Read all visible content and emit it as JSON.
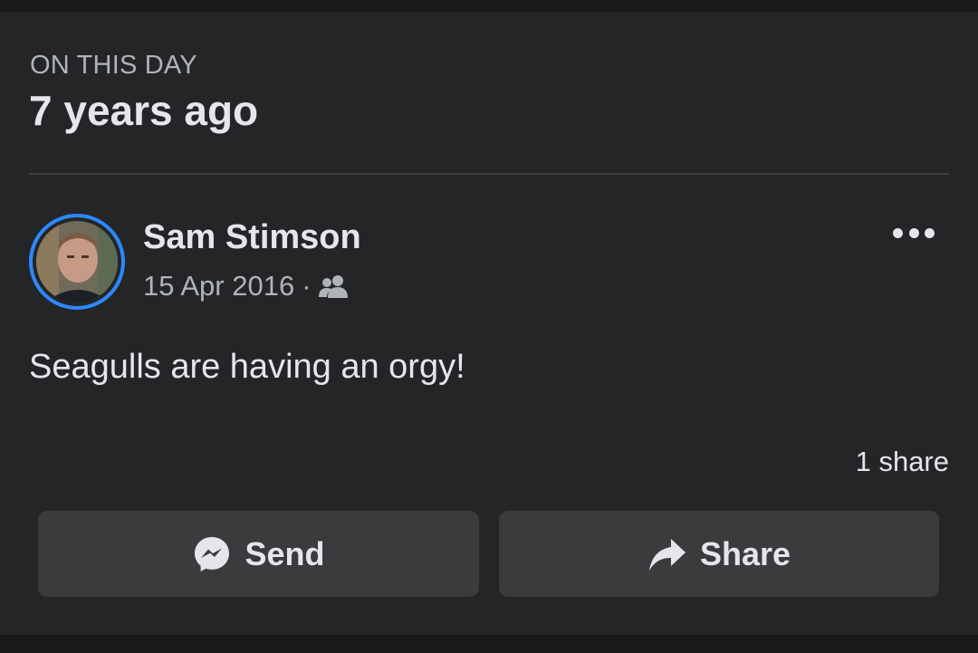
{
  "memory": {
    "eyebrow": "ON THIS DAY",
    "heading": "7 years ago"
  },
  "post": {
    "author": "Sam Stimson",
    "date": "15 Apr 2016",
    "separator": "·",
    "audience_icon": "friends-icon",
    "more_icon": "more-options-icon",
    "text": "Seagulls are having an orgy!",
    "share_count": "1 share"
  },
  "actions": {
    "send_label": "Send",
    "send_icon": "messenger-icon",
    "share_label": "Share",
    "share_icon": "share-arrow-icon"
  },
  "colors": {
    "page_bg": "#18191a",
    "card_bg": "#242526",
    "button_bg": "#3a3b3c",
    "primary_text": "#e4e6eb",
    "secondary_text": "#b0b3b8",
    "avatar_ring": "#2d88ff"
  }
}
